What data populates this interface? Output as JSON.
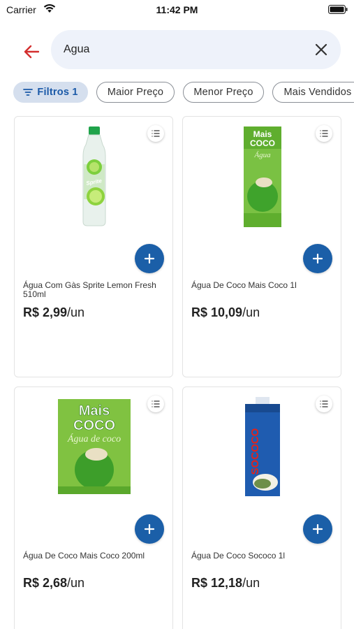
{
  "status_bar": {
    "carrier": "Carrier",
    "time": "11:42 PM"
  },
  "search": {
    "value": "Agua"
  },
  "filters": {
    "filter_chip_label": "Filtros",
    "filter_count": "1",
    "chips": [
      "Maior Preço",
      "Menor Preço",
      "Mais Vendidos"
    ]
  },
  "products": [
    {
      "name": "Água Com Gàs Sprite Lemon Fresh 510ml",
      "price": "R$ 2,99",
      "unit": "/un",
      "image": "sprite-bottle"
    },
    {
      "name": "Água De Coco Mais Coco 1l",
      "price": "R$ 10,09",
      "unit": "/un",
      "image": "mais-coco-box-1l"
    },
    {
      "name": "Água De Coco Mais Coco 200ml",
      "price": "R$ 2,68",
      "unit": "/un",
      "image": "mais-coco-box-200ml"
    },
    {
      "name": "Água De Coco Sococo 1l",
      "price": "R$ 12,18",
      "unit": "/un",
      "image": "sococo-box-1l"
    }
  ],
  "colors": {
    "accent": "#1b5fa8",
    "back_arrow": "#d32f2f",
    "chip_active_bg": "#d5dfee",
    "search_bg": "#eef2fa"
  }
}
